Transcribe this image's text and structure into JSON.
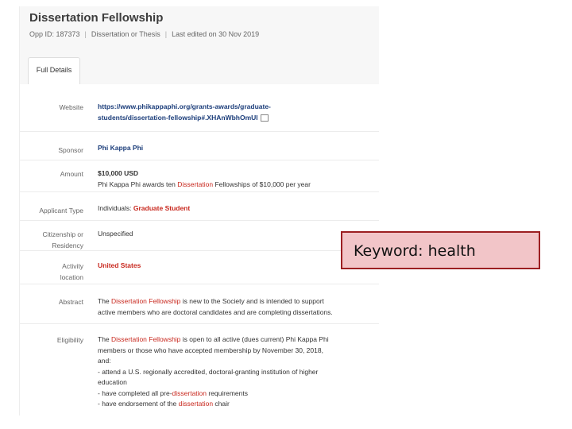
{
  "header": {
    "title": "Dissertation Fellowship",
    "opp_id": "Opp ID: 187373",
    "type": "Dissertation or Thesis",
    "edited": "Last edited on 30 Nov 2019"
  },
  "tabs": [
    {
      "label": "Full Details"
    }
  ],
  "details": {
    "website": {
      "label": "Website",
      "line1": "https://www.phikappaphi.org/grants-awards/graduate-",
      "line2": "students/dissertation-fellowship#.XHAnWbhOmUl"
    },
    "sponsor": {
      "label": "Sponsor",
      "value": "Phi Kappa Phi"
    },
    "amount": {
      "label": "Amount",
      "value": "$10,000 USD",
      "desc_before": "Phi Kappa Phi awards ten ",
      "desc_hl": "Dissertation",
      "desc_after": " Fellowships of $10,000 per year"
    },
    "applicant_type": {
      "label": "Applicant Type",
      "prefix": "Individuals: ",
      "value": "Graduate Student"
    },
    "citizenship": {
      "label1": "Citizenship or",
      "label2": "Residency",
      "value": "Unspecified"
    },
    "activity": {
      "label1": "Activity",
      "label2": "location",
      "value": "United States"
    },
    "abstract": {
      "label": "Abstract",
      "l1_before": "The ",
      "l1_hl": "Dissertation Fellowship",
      "l1_after": " is new to the Society and is intended to support",
      "l2": "active members who are doctoral candidates and are completing dissertations."
    },
    "eligibility": {
      "label": "Eligibility",
      "l1_before": "The ",
      "l1_hl": "Dissertation Fellowship",
      "l1_after": " is open to all active (dues current) Phi Kappa Phi",
      "l2": "members or those who have accepted membership by November 30, 2018,",
      "l3": "and:",
      "l4": "- attend a U.S. regionally accredited, doctoral-granting institution of higher",
      "l5": "education",
      "l6_before": "- have completed all pre-",
      "l6_hl": "dissertation",
      "l6_after": " requirements",
      "l7_before": "- have endorsement of the ",
      "l7_hl": "dissertation",
      "l7_after": " chair"
    }
  },
  "callout": {
    "text": "Keyword: health"
  }
}
